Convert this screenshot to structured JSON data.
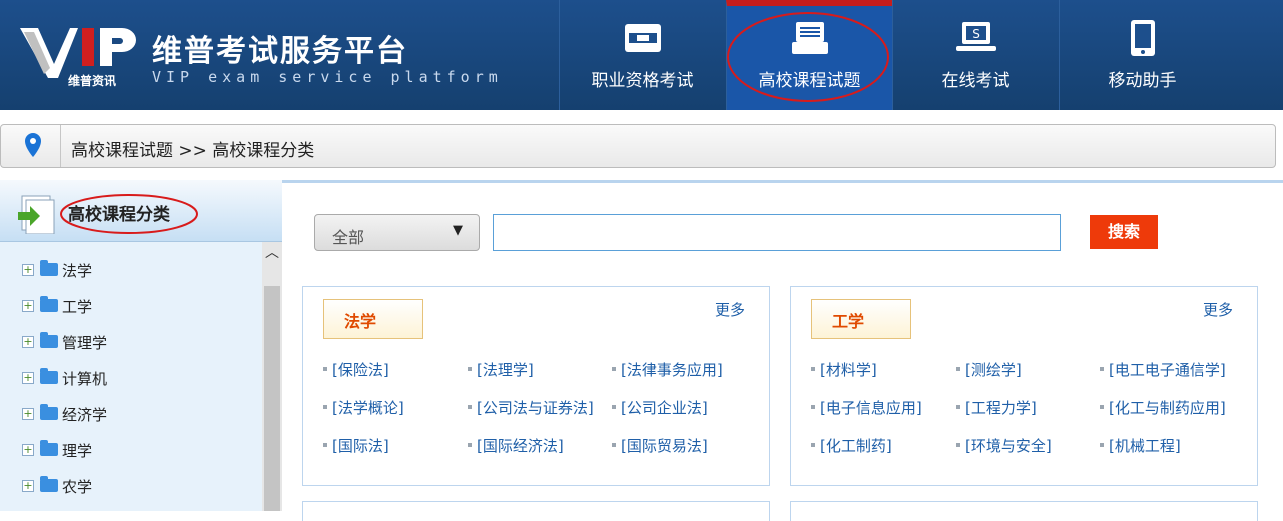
{
  "brand": {
    "title": "维普考试服务平台",
    "subtitle": "VIP exam service platform",
    "small": "维普资讯",
    "logo_text": "VIP"
  },
  "nav": [
    {
      "label": "职业资格考试",
      "icon": "id-card-icon"
    },
    {
      "label": "高校课程试题",
      "icon": "printer-icon",
      "active": true
    },
    {
      "label": "在线考试",
      "icon": "laptop-icon"
    },
    {
      "label": "移动助手",
      "icon": "tablet-icon"
    }
  ],
  "breadcrumb": {
    "text": "高校课程试题 >> 高校课程分类",
    "icon": "location-pin-icon"
  },
  "sidebar": {
    "title": "高校课程分类",
    "icon": "document-arrow-icon",
    "items": [
      {
        "label": "法学"
      },
      {
        "label": "工学"
      },
      {
        "label": "管理学"
      },
      {
        "label": "计算机"
      },
      {
        "label": "经济学"
      },
      {
        "label": "理学"
      },
      {
        "label": "农学"
      }
    ]
  },
  "search": {
    "select_value": "全部",
    "placeholder": "",
    "button": "搜索"
  },
  "panels": [
    {
      "title": "法学",
      "more": "更多",
      "links": [
        "[保险法]",
        "[法理学]",
        "[法律事务应用]",
        "[法学概论]",
        "[公司法与证券法]",
        "[公司企业法]",
        "[国际法]",
        "[国际经济法]",
        "[国际贸易法]"
      ]
    },
    {
      "title": "工学",
      "more": "更多",
      "links": [
        "[材料学]",
        "[测绘学]",
        "[电工电子通信学]",
        "[电子信息应用]",
        "[工程力学]",
        "[化工与制药应用]",
        "[化工制药]",
        "[环境与安全]",
        "[机械工程]"
      ]
    }
  ],
  "colors": {
    "header_bg": "#1d4f8c",
    "active_nav": "#1a56a8",
    "search_button": "#ee3a0a",
    "link": "#1f5fa8",
    "panel_title": "#e04a00"
  }
}
